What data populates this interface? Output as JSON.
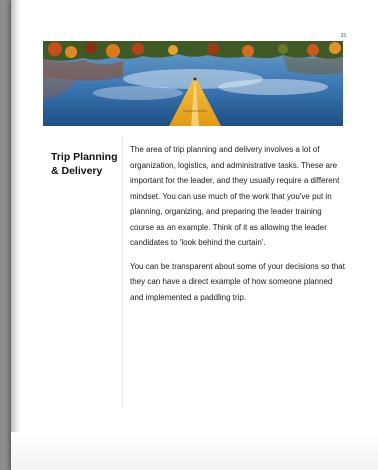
{
  "page": {
    "number": "33"
  },
  "section": {
    "heading": "Trip Planning\n& Delivery",
    "paragraphs": [
      "The area of trip planning and delivery involves a lot of organization, logistics, and administrative tasks. These are important for the leader, and they usually require a different mindset. You can use much of the work that you've put in planning, organizing, and preparing the leader training course as an example. Think of it as allowing the leader candidates to 'look behind the curtain'.",
      "You can be transparent about some of your decisions so that they can have a direct example of how someone planned and implemented a paddling trip."
    ]
  },
  "colors": {
    "page_background": "#ffffff",
    "backdrop": "#8d8d8d",
    "kayak": "#f0b429",
    "water": "#3a78b8"
  }
}
